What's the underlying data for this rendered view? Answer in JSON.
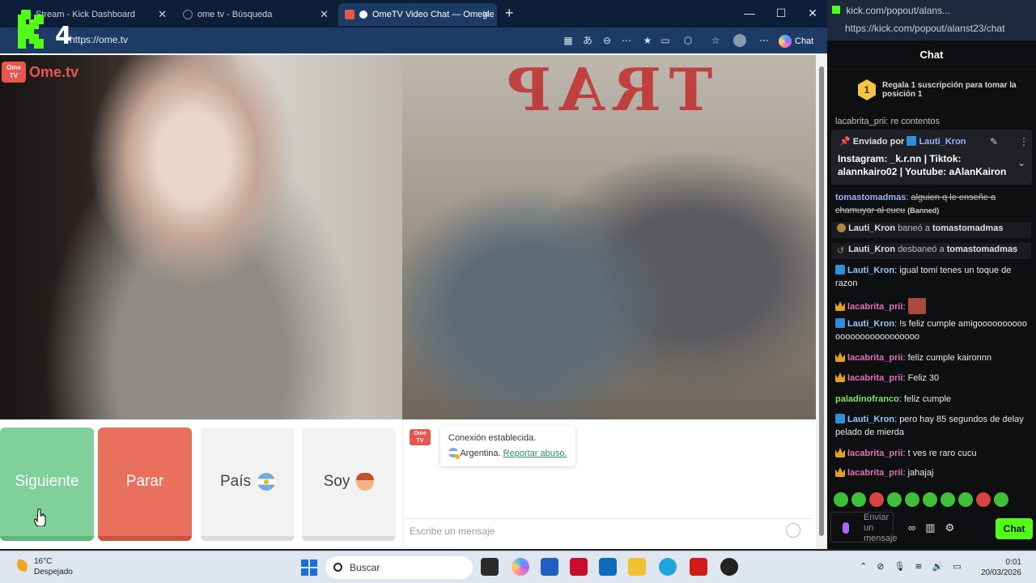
{
  "browser": {
    "tabs": [
      {
        "label": "Stream - Kick Dashboard",
        "active": false
      },
      {
        "label": "ome tv - Búsqueda",
        "active": false
      },
      {
        "label": "OmeTV Video Chat — Omegle",
        "active": true
      }
    ],
    "url": "https://ome.tv",
    "copilot_label": "Chat",
    "overlay_logo": "K4"
  },
  "ometv": {
    "logo_box": "Ome TV",
    "logo_word": "Ome.tv",
    "mirrored_wall_text": "TRAP",
    "buttons": {
      "next": "Siguiente",
      "stop": "Parar",
      "country": "País",
      "gender": "Soy"
    },
    "system_message": {
      "line1": "Conexión establecida.",
      "country": "Argentina.",
      "report_link": "Reportar abuso."
    },
    "message_placeholder": "Escribe un mensaje"
  },
  "kick": {
    "window_title": "kick.com/popout/alans...",
    "url": "https://kick.com/popout/alanst23/chat",
    "header": "Chat",
    "gift": {
      "rank": "1",
      "text": "Regala 1 suscripción para tomar la posición 1"
    },
    "partial_top": "lacabrita_prii: re contentos",
    "pinned": {
      "prefix": "Enviado por",
      "user": "Lauti_Kron",
      "body": "Instagram: _k.r.nn | Tiktok: alannkairo02 | Youtube: aAlanKairon"
    },
    "messages": [
      {
        "user": "tomastomadmas",
        "text": "alguien q le enseñe a chamuyar al cucu",
        "tag": "(Banned)"
      },
      {
        "sys": true,
        "actor": "Lauti_Kron",
        "action": "baneó a",
        "target": "tomastomadmas"
      },
      {
        "sys": true,
        "actor": "Lauti_Kron",
        "action": "desbaneó a",
        "target": "tomastomadmas"
      },
      {
        "user": "Lauti_Kron",
        "text": "igual tomi tenes un toque de razon"
      },
      {
        "user": "lacabrita_prii",
        "text": ""
      },
      {
        "user": "Lauti_Kron",
        "text": "!s feliz cumple amigooooooooooooooooooooooooooo"
      },
      {
        "user": "lacabrita_prii",
        "text": "feliz cumple kaironnn"
      },
      {
        "user": "lacabrita_prii",
        "text": "Feliz 30"
      },
      {
        "user": "paladinofranco",
        "text": "feliz cumple"
      },
      {
        "user": "Lauti_Kron",
        "text": "pero hay 85 segundos de delay pelado de mierda"
      },
      {
        "user": "lacabrita_prii",
        "text": "t ves re raro cucu"
      },
      {
        "user": "lacabrita_prii",
        "text": "jahajaj"
      }
    ],
    "input_placeholder": "Enviar un mensaje",
    "chat_button": "Chat"
  },
  "taskbar": {
    "temp": "16°C",
    "weather": "Despejado",
    "search": "Buscar",
    "time": "0:01",
    "date": "20/03/2026"
  }
}
